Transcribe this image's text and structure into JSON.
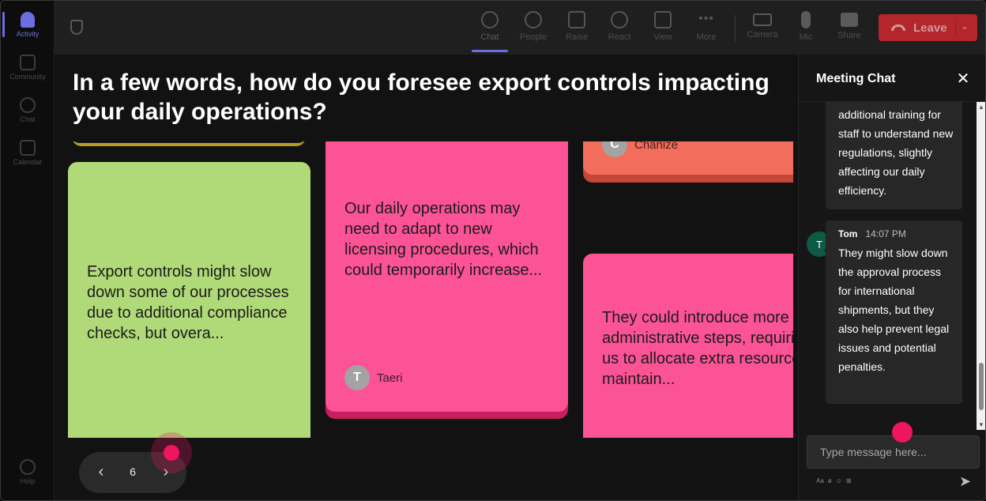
{
  "rail": {
    "items": [
      {
        "label": "Activity",
        "icon": "bell-icon",
        "active": true
      },
      {
        "label": "Community",
        "icon": "community-icon"
      },
      {
        "label": "Chat",
        "icon": "chat-icon"
      },
      {
        "label": "Calendar",
        "icon": "calendar-icon"
      },
      {
        "label": "Help",
        "icon": "help-icon"
      }
    ]
  },
  "toolbar": {
    "chat": "Chat",
    "people": "People",
    "raise": "Raise",
    "react": "React",
    "view": "View",
    "more": "More",
    "camera": "Camera",
    "mic": "Mic",
    "share": "Share",
    "leave": "Leave",
    "more_glyph": "•••"
  },
  "main": {
    "question": "In a few words, how do you foresee export controls impacting your daily operations?",
    "cards": [
      {
        "text": "Export controls might slow down some of our processes due to additional compliance checks, but overa...",
        "color": "#b0d978"
      },
      {
        "text": "Our daily operations may need to adapt to new licensing procedures, which could temporarily increase...",
        "author": "Taeri",
        "initial": "T",
        "color": "#fb5396"
      },
      {
        "author": "Chanize",
        "initial": "C",
        "color": "#f26d5c"
      },
      {
        "text": "They could introduce more administrative steps, requiring us to allocate extra resources to maintain...",
        "color": "#fb5396"
      }
    ],
    "page": "6"
  },
  "chat": {
    "title": "Meeting Chat",
    "messages": [
      {
        "text": "additional training for staff to understand new regulations, slightly affecting our daily efficiency."
      },
      {
        "author": "Tom",
        "initial": "T",
        "time": "14:07 PM",
        "text": "They might slow down the approval process for international shipments, but they also help prevent legal issues and potential penalties."
      }
    ],
    "placeholder": "Type message here...",
    "tools": [
      "Aa",
      "ø",
      "☺",
      "⊞"
    ]
  },
  "colors": {
    "accent": "#6b6ee0",
    "leave": "#c4272d",
    "cursor": "#f0155f",
    "avatar_tom": "#0d5a45"
  }
}
